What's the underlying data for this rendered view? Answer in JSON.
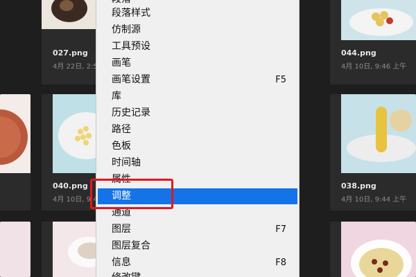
{
  "gallery": {
    "cards": [
      {
        "id": "027",
        "name": "027.png",
        "date": "4月 22日, 2:5"
      },
      {
        "id": "044",
        "name": "044.png",
        "date": "4月 10日, 9:46 上午"
      },
      {
        "id": "040",
        "name": "040.png",
        "date": "4月 10日, 9:4"
      },
      {
        "id": "038",
        "name": "038.png",
        "date": "4月 10日, 9:44 上午"
      }
    ]
  },
  "menu": {
    "items": [
      {
        "label": "段落",
        "shortcut": ""
      },
      {
        "label": "段落样式",
        "shortcut": ""
      },
      {
        "label": "仿制源",
        "shortcut": ""
      },
      {
        "label": "工具预设",
        "shortcut": ""
      },
      {
        "label": "画笔",
        "shortcut": ""
      },
      {
        "label": "画笔设置",
        "shortcut": "F5"
      },
      {
        "label": "库",
        "shortcut": ""
      },
      {
        "label": "历史记录",
        "shortcut": ""
      },
      {
        "label": "路径",
        "shortcut": ""
      },
      {
        "label": "色板",
        "shortcut": ""
      },
      {
        "label": "时间轴",
        "shortcut": ""
      },
      {
        "label": "属性",
        "shortcut": ""
      },
      {
        "label": "调整",
        "shortcut": ""
      },
      {
        "label": "通道",
        "shortcut": ""
      },
      {
        "label": "图层",
        "shortcut": "F7"
      },
      {
        "label": "图层复合",
        "shortcut": ""
      },
      {
        "label": "信息",
        "shortcut": "F8"
      },
      {
        "label": "修改键",
        "shortcut": ""
      }
    ],
    "selected_index": 12
  },
  "colors": {
    "menu_selected": "#1473e6",
    "annotation_box": "#e8141c"
  }
}
